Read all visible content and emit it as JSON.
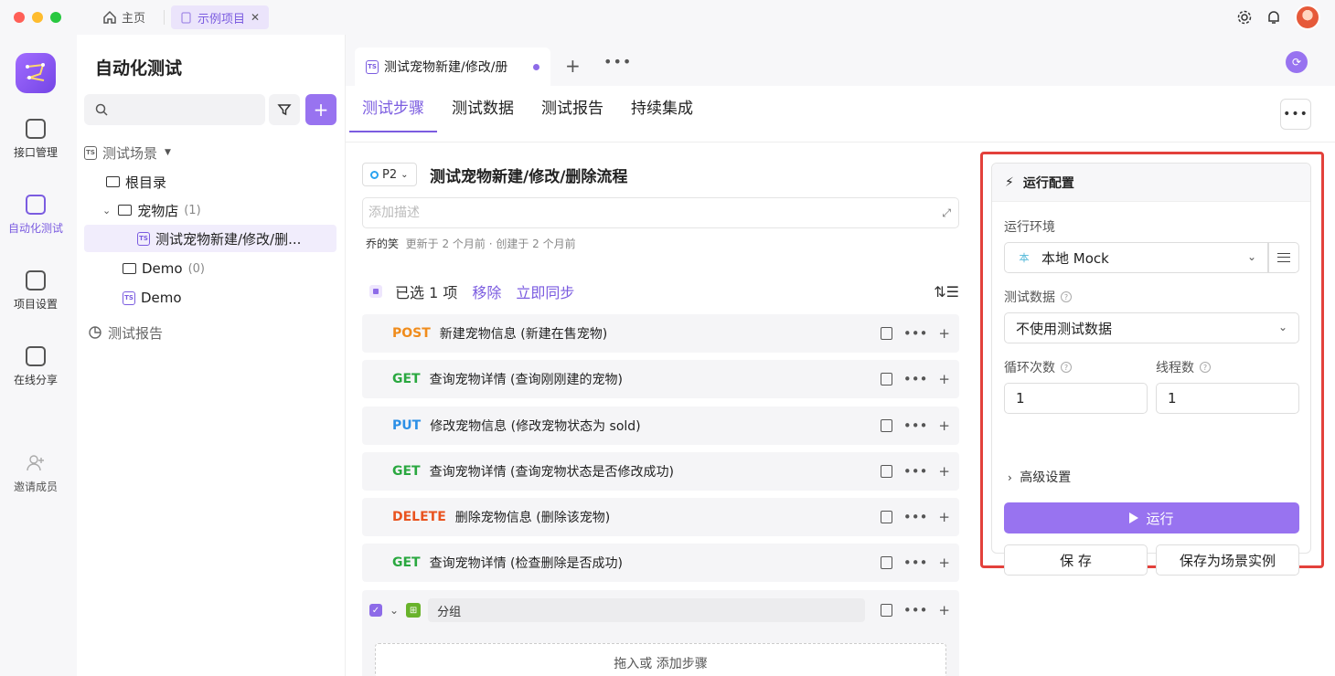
{
  "titlebar": {
    "home_label": "主页",
    "tab_label": "示例项目",
    "tab_close": "✕"
  },
  "rail": {
    "items": [
      {
        "label": "接口管理"
      },
      {
        "label": "自动化测试"
      },
      {
        "label": "项目设置"
      },
      {
        "label": "在线分享"
      },
      {
        "label": "邀请成员"
      }
    ]
  },
  "sidebar": {
    "title": "自动化测试",
    "search_placeholder": "",
    "tree": {
      "scenes_label": "测试场景",
      "root_label": "根目录",
      "petshop_label": "宠物店",
      "petshop_count": "(1)",
      "case_label": "测试宠物新建/修改/删...",
      "demo_folder_label": "Demo",
      "demo_folder_count": "(0)",
      "demo_case_label": "Demo",
      "reports_label": "测试报告"
    }
  },
  "doc_tab": {
    "title": "测试宠物新建/修改/册"
  },
  "sub_tabs": [
    "测试步骤",
    "测试数据",
    "测试报告",
    "持续集成"
  ],
  "case": {
    "priority": "P2",
    "title": "测试宠物新建/修改/删除流程",
    "desc_placeholder": "添加描述",
    "author": "乔的笑",
    "meta": "更新于 2 个月前 · 创建于 2 个月前"
  },
  "selection": {
    "label": "已选 1 项",
    "remove": "移除",
    "sync": "立即同步"
  },
  "steps": [
    {
      "method": "POST",
      "name": "新建宠物信息 (新建在售宠物)"
    },
    {
      "method": "GET",
      "name": "查询宠物详情 (查询刚刚建的宠物)"
    },
    {
      "method": "PUT",
      "name": "修改宠物信息 (修改宠物状态为 sold)"
    },
    {
      "method": "GET",
      "name": "查询宠物详情 (查询宠物状态是否修改成功)"
    },
    {
      "method": "DELETE",
      "name": "删除宠物信息 (删除该宠物)"
    },
    {
      "method": "GET",
      "name": "查询宠物详情 (检查删除是否成功)"
    }
  ],
  "group": {
    "name": "分组",
    "drop_text": "拖入或 添加步骤"
  },
  "run_config": {
    "title": "运行配置",
    "env_label": "运行环境",
    "env_badge": "本",
    "env_value": "本地 Mock",
    "data_label": "测试数据",
    "data_value": "不使用测试数据",
    "loops_label": "循环次数",
    "loops_value": "1",
    "threads_label": "线程数",
    "threads_value": "1",
    "advanced_label": "高级设置",
    "run_label": "运行",
    "save_label": "保 存",
    "save_as_label": "保存为场景实例"
  },
  "colors": {
    "accent": "#9873f0",
    "post": "#f08c1c",
    "get": "#2aa840",
    "put": "#2b8fe6",
    "delete": "#e9531f",
    "highlight": "#e3413b"
  }
}
